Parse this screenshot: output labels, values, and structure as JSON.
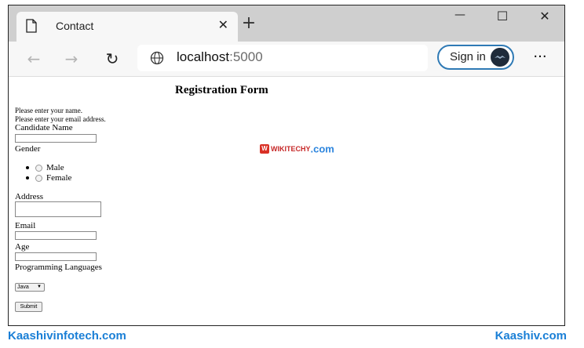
{
  "browser": {
    "tab": {
      "title": "Contact",
      "close_glyph": "✕",
      "icon": "page-icon"
    },
    "new_tab_glyph": "+",
    "window_controls": {
      "minimize": "—",
      "maximize": "☐",
      "close": "✕"
    },
    "nav": {
      "back": "←",
      "forward": "→",
      "refresh": "↻"
    },
    "address": {
      "host": "localhost",
      "port": ":5000"
    },
    "sign_in_label": "Sign in",
    "more_glyph": "···"
  },
  "page": {
    "title": "Registration Form",
    "messages": [
      "Please enter your name.",
      "Please enter your email address."
    ],
    "candidate_name_label": "Candidate Name",
    "gender_label": "Gender",
    "gender_options": [
      "Male",
      "Female"
    ],
    "address_label": "Address",
    "email_label": "Email",
    "age_label": "Age",
    "programming_languages_label": "Programming Languages",
    "language_selected": "Java",
    "submit_label": "Submit"
  },
  "watermark": {
    "badge": "W",
    "text": "WIKITECHY",
    "suffix": ".com"
  },
  "footer": {
    "left": "Kaashivinfotech.com",
    "right": "Kaashiv.com"
  },
  "colors": {
    "accent": "#2f7ab5",
    "footer_brand": "#1a7fd6",
    "tabstrip": "#cfcfcf"
  }
}
